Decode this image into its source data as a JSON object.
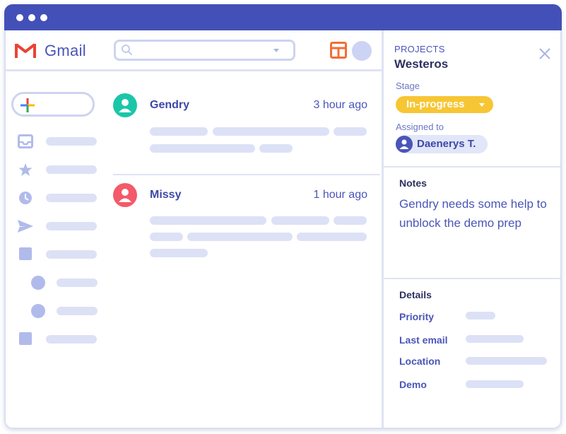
{
  "app": {
    "name": "Gmail"
  },
  "search": {
    "placeholder": ""
  },
  "mails": [
    {
      "sender": "Gendry",
      "time": "3 hour ago",
      "avatar_color": "#1bc6a8"
    },
    {
      "sender": "Missy",
      "time": "1 hour ago",
      "avatar_color": "#f35a6a"
    }
  ],
  "panel": {
    "section": "PROJECTS",
    "title": "Westeros",
    "stage_label": "Stage",
    "stage_value": "In-progress",
    "assigned_label": "Assigned to",
    "assignee": "Daenerys T.",
    "notes_heading": "Notes",
    "notes_text": "Gendry needs some help to unblock the demo prep",
    "details_heading": "Details",
    "details": [
      {
        "label": "Priority"
      },
      {
        "label": "Last email"
      },
      {
        "label": "Location"
      },
      {
        "label": "Demo"
      }
    ]
  },
  "colors": {
    "titlebar": "#4350b8",
    "accent": "#4a55b8",
    "stage": "#f7c634",
    "placeholder_bar": "#dce1f6"
  },
  "icons": [
    "gmail-logo-icon",
    "search-icon",
    "layout-icon",
    "plus-icon",
    "inbox-icon",
    "star-icon",
    "clock-icon",
    "send-icon",
    "folder-icon",
    "close-icon",
    "user-icon"
  ]
}
